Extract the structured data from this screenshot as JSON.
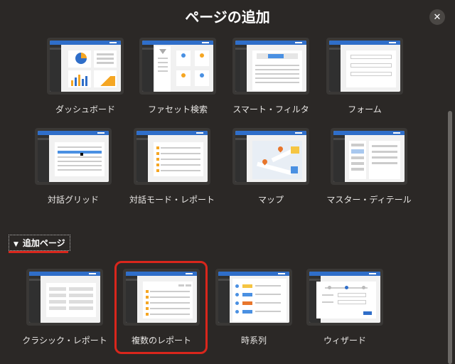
{
  "dialog": {
    "title": "ページの追加",
    "close_label": "✕"
  },
  "templates": [
    {
      "label": "ダッシュボード",
      "icon": "dashboard-icon"
    },
    {
      "label": "ファセット検索",
      "icon": "facet-search-icon"
    },
    {
      "label": "スマート・フィルタ",
      "icon": "smart-filter-icon"
    },
    {
      "label": "フォーム",
      "icon": "form-icon"
    },
    {
      "label": "対話グリッド",
      "icon": "interactive-grid-icon"
    },
    {
      "label": "対話モード・レポート",
      "icon": "interactive-report-icon"
    },
    {
      "label": "マップ",
      "icon": "map-icon"
    },
    {
      "label": "マスター・ディテール",
      "icon": "master-detail-icon"
    }
  ],
  "additional": {
    "section_label": "追加ページ",
    "items": [
      {
        "label": "クラシック・レポート",
        "icon": "classic-report-icon"
      },
      {
        "label": "複数のレポート",
        "icon": "multiple-reports-icon"
      },
      {
        "label": "時系列",
        "icon": "timeline-icon"
      },
      {
        "label": "ウィザード",
        "icon": "wizard-icon"
      }
    ]
  },
  "colors": {
    "accent": "#2f6ec9",
    "highlight": "#d9261c",
    "background": "#2b2826"
  }
}
